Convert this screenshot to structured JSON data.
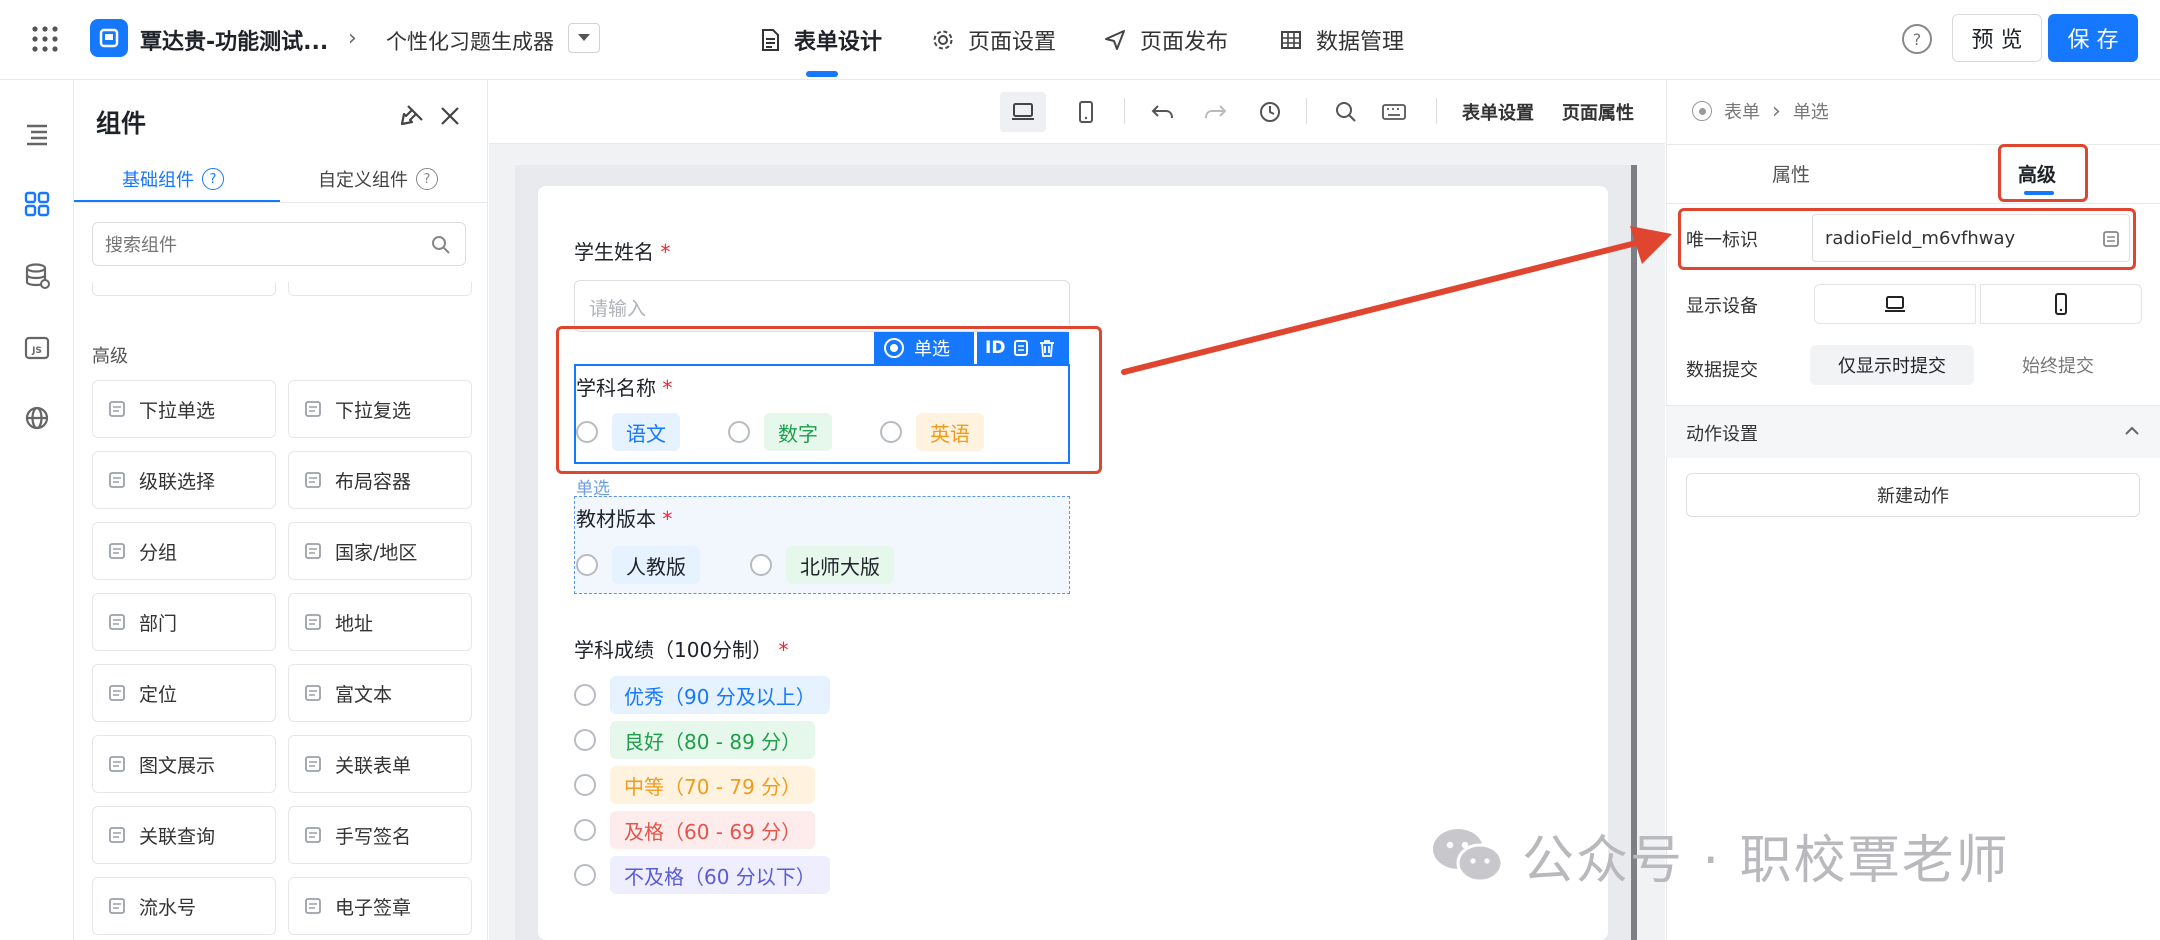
{
  "topbar": {
    "app_title": "覃达贵-功能测试...",
    "page_name": "个性化习题生成器",
    "tabs": [
      {
        "label": "表单设计",
        "icon": "document-icon",
        "active": true
      },
      {
        "label": "页面设置",
        "icon": "gear-icon",
        "active": false
      },
      {
        "label": "页面发布",
        "icon": "send-icon",
        "active": false
      },
      {
        "label": "数据管理",
        "icon": "table-icon",
        "active": false
      }
    ],
    "preview_label": "预 览",
    "save_label": "保 存"
  },
  "panel": {
    "title": "组件",
    "tabs": [
      "基础组件",
      "自定义组件"
    ],
    "search_placeholder": "搜索组件",
    "section_label": "高级",
    "components": [
      {
        "label": "下拉单选",
        "icon": "dropdown-single-icon"
      },
      {
        "label": "下拉复选",
        "icon": "dropdown-multi-icon"
      },
      {
        "label": "级联选择",
        "icon": "cascade-icon"
      },
      {
        "label": "布局容器",
        "icon": "layout-icon"
      },
      {
        "label": "分组",
        "icon": "group-icon"
      },
      {
        "label": "国家/地区",
        "icon": "globe-icon"
      },
      {
        "label": "部门",
        "icon": "department-icon"
      },
      {
        "label": "地址",
        "icon": "address-icon"
      },
      {
        "label": "定位",
        "icon": "location-icon"
      },
      {
        "label": "富文本",
        "icon": "richtext-icon"
      },
      {
        "label": "图文展示",
        "icon": "image-text-icon"
      },
      {
        "label": "关联表单",
        "icon": "link-form-icon"
      },
      {
        "label": "关联查询",
        "icon": "link-query-icon"
      },
      {
        "label": "手写签名",
        "icon": "signature-icon"
      },
      {
        "label": "流水号",
        "icon": "serial-icon"
      },
      {
        "label": "电子签章",
        "icon": "stamp-icon"
      }
    ]
  },
  "toolbar": {
    "form_settings": "表单设置",
    "page_props": "页面属性"
  },
  "form": {
    "name_label": "学生姓名",
    "name_placeholder": "请输入",
    "selected_toolbar": {
      "type_label": "单选",
      "id_label": "ID"
    },
    "subject_label": "学科名称",
    "subject_options": [
      {
        "label": "语文",
        "bg": "#e6f2ff",
        "fg": "#1677ff"
      },
      {
        "label": "数字",
        "bg": "#e6f7ec",
        "fg": "#1e9e4a"
      },
      {
        "label": "英语",
        "bg": "#fff3e0",
        "fg": "#f29a1b"
      }
    ],
    "hover_tag": "单选",
    "textbook_label": "教材版本",
    "textbook_options": [
      {
        "label": "人教版",
        "bg": "#e6f2ff",
        "fg": "#1f2329"
      },
      {
        "label": "北师大版",
        "bg": "#e6f7ec",
        "fg": "#1f2329"
      }
    ],
    "score_label": "学科成绩（100分制）",
    "score_options": [
      {
        "label": "优秀（90 分及以上）",
        "bg": "#e6f2ff",
        "fg": "#1677ff"
      },
      {
        "label": "良好（80 - 89 分）",
        "bg": "#e6f7ec",
        "fg": "#1e9e4a"
      },
      {
        "label": "中等（70 - 79 分）",
        "bg": "#fff3e0",
        "fg": "#f29a1b"
      },
      {
        "label": "及格（60 - 69 分）",
        "bg": "#fdeceb",
        "fg": "#e5534b"
      },
      {
        "label": "不及格（60 分以下）",
        "bg": "#eeeeff",
        "fg": "#5b5bd6"
      }
    ]
  },
  "rpanel": {
    "breadcrumb": [
      "表单",
      "单选"
    ],
    "tabs": [
      "属性",
      "高级"
    ],
    "unique_id_label": "唯一标识",
    "unique_id_value": "radioField_m6vfhway",
    "device_label": "显示设备",
    "submit_label": "数据提交",
    "submit_options": [
      "仅显示时提交",
      "始终提交"
    ],
    "action_section": "动作设置",
    "new_action": "新建动作"
  },
  "watermark": "公众号 · 职校覃老师",
  "colors": {
    "accent": "#1677ff",
    "annotation": "#e0452f"
  }
}
